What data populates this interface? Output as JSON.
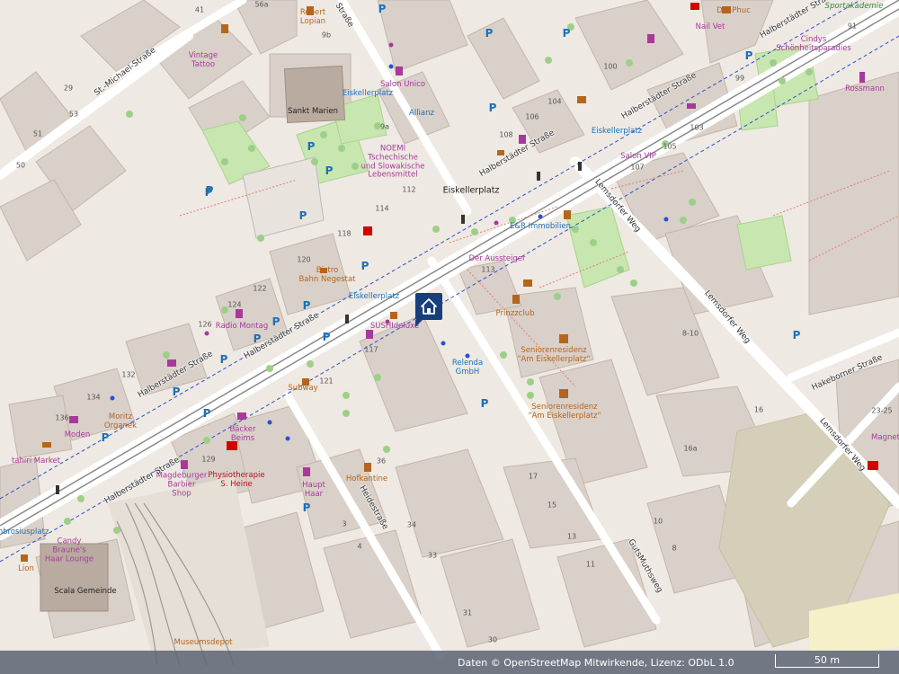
{
  "streets": {
    "st_michael": "St.-Michael-Straße",
    "halberstaedter_1": "Halberstädter Straße",
    "halberstaedter_2": "Halberstädter Straße",
    "halberstaedter_3": "Halberstädter Straße",
    "halberstaedter_4": "Halberstädter Straße",
    "halberstaedter_5": "Halberstädter Straße",
    "halberstaedter_6": "Halberstädter Straße",
    "strasse_top": "Straße",
    "lemsdorfer_1": "Lemsdorfer Weg",
    "lemsdorfer_2": "Lemsdorfer Weg",
    "lemsdorfer_3": "Lemsdorfer Weg",
    "hakeborner": "Hakeborner Straße",
    "heidestrasse": "Heidestraße",
    "gutsmuthsweg": "GutsMuthsweg"
  },
  "places": {
    "eiskellerplatz": "Eiskellerplatz",
    "robert_lopian": "Robert\nLopian",
    "vintage_tattoo": "Vintage\nTattoo",
    "sankt_marien": "Sankt Marien",
    "salon_unico": "Salon Unico",
    "eiskellerplatz_stop1": "Eiskellerplatz",
    "allianz": "Allianz",
    "noemi": "NOEMI\nTschechische\nund Slowakische\nLebensmittel",
    "dai_phuc": "Dai-Phuc",
    "nail_vet": "Nail Vet",
    "sportakademie": "Sportakademie",
    "cindys": "Cindys\nSchönheitsparadies",
    "rossmann": "Rossmann",
    "eiskellerplatz_stop2": "Eiskellerplatz",
    "salon_vip": "Salon VIP",
    "er_immobilien": "E&R Immobilien",
    "der_aussteiger": "Der Aussteiger",
    "bistro": "Bistro\nBahn Negestat",
    "eiskellerplatz_stop3": "Eiskellerplatz",
    "prinzzclub": "Prinzzclub",
    "sushideluxe": "SUSHIdeluxe",
    "radio_montag": "Radio Montag",
    "relenda": "Relenda\nGmbH",
    "seniorenresidenz_1": "Seniorenresidenz\n\"Am Eiskellerplatz\"",
    "seniorenresidenz_2": "Seniorenresidenz\n\"Am Eiskellerplatz\"",
    "subway": "Subway",
    "moritz": "Moritz\nOrganek",
    "moden": "Moden",
    "tahiri": "tahiri Market",
    "baecker_beims": "Bäcker\nBeims",
    "magdeburger_barbier": "Magdeburger\nBarbier\nShop",
    "physiotherapie": "Physiotherapie\nS. Heine",
    "haupt_haar": "Haupt\nHaar",
    "hofkantine": "Hofkantine",
    "ambrosiusplatz": "ambrosiusplatz",
    "candy": "Candy\nBraune's\nHaar Lounge",
    "lion": "Lion",
    "scala": "Scala Gemeinde",
    "museumsdepot": "Museumsdepot",
    "magnet": "Magnet"
  },
  "house_numbers": {
    "n56a": "56a",
    "n9b": "9b",
    "n9a": "9a",
    "n53": "53",
    "n51": "51",
    "n50": "50",
    "n41": "41",
    "n29": "29",
    "n112": "112",
    "n114": "114",
    "n118": "118",
    "n120": "120",
    "n122": "122",
    "n124": "124",
    "n126": "126",
    "n132": "132",
    "n134": "134",
    "n136": "136",
    "n100": "100",
    "n104": "104",
    "n106": "106",
    "n108": "108",
    "n99": "99",
    "n103": "103",
    "n105": "105",
    "n107": "107",
    "n113": "113",
    "n117": "117",
    "n121": "121",
    "n129": "129",
    "n810": "8-10",
    "n16": "16",
    "n16a": "16a",
    "n17": "17",
    "n15": "15",
    "n13": "13",
    "n11": "11",
    "n10": "10",
    "n8": "8",
    "n36": "36",
    "n34": "34",
    "n33": "33",
    "n31": "31",
    "n30": "30",
    "n3": "3",
    "n4": "4",
    "n91": "91",
    "n2325": "23-25"
  },
  "footer": {
    "attribution": "Daten © OpenStreetMap Mitwirkende, Lizenz: ODbL 1.0",
    "scale": "50 m"
  },
  "icons": {
    "marker": "home-marker-icon",
    "parking": "parking-icon"
  },
  "colors": {
    "background": "#f2efe9",
    "building": "#d9d0c9",
    "road_major": "#ffffff",
    "park": "#c8e6b0",
    "poi": "#a8399c",
    "transport": "#1f6fb8",
    "marker": "#173f7a"
  }
}
